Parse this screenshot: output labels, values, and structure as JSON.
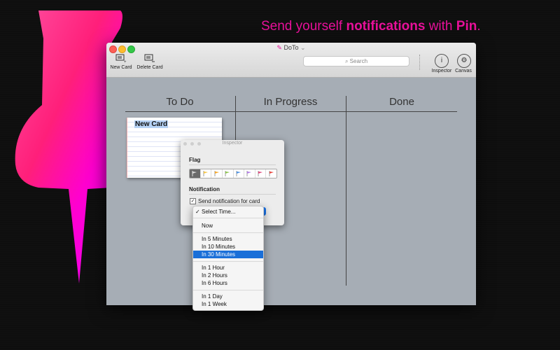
{
  "headline": {
    "part1": "Send yourself ",
    "part2": "notifications",
    "part3": " with ",
    "part4": "Pin",
    "part5": "."
  },
  "window": {
    "title": "DoTo"
  },
  "toolbar": {
    "new_card": "New Card",
    "delete_card": "Delete Card",
    "search_placeholder": "Search",
    "inspector": "Inspector",
    "canvas": "Canvas"
  },
  "board": {
    "columns": [
      "To Do",
      "In Progress",
      "Done"
    ]
  },
  "card": {
    "title": "New Card"
  },
  "inspector": {
    "title": "Inspector",
    "flag_label": "Flag",
    "notification_label": "Notification",
    "checkbox_label": "Send notification for card",
    "checkbox_checked": "✓",
    "flag_colors": [
      "#444444",
      "#f5c542",
      "#f5a623",
      "#8bc34a",
      "#4a90e2",
      "#b17ae6",
      "#e0447a",
      "#e8423b"
    ]
  },
  "menu": {
    "items": [
      {
        "label": "Select Time...",
        "checked": true
      },
      {
        "label": "Now"
      },
      {
        "label": "In 5 Minutes"
      },
      {
        "label": "In 10 Minutes"
      },
      {
        "label": "In 30 Minutes",
        "highlighted": true
      },
      {
        "label": "In 1 Hour"
      },
      {
        "label": "In 2 Hours"
      },
      {
        "label": "In 6 Hours"
      },
      {
        "label": "In 1 Day"
      },
      {
        "label": "In 1 Week"
      }
    ]
  },
  "colors": {
    "pin": "#ff00cc",
    "headline": "#e8109a",
    "selection": "#1a6fd8"
  }
}
